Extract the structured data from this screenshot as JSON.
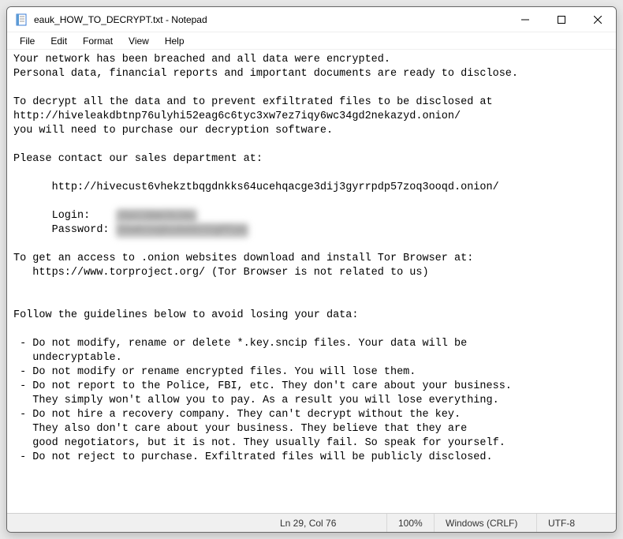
{
  "titlebar": {
    "title": "eauk_HOW_TO_DECRYPT.txt - Notepad"
  },
  "menu": {
    "file": "File",
    "edit": "Edit",
    "format": "Format",
    "view": "View",
    "help": "Help"
  },
  "body": {
    "l1": "Your network has been breached and all data were encrypted.",
    "l2": "Personal data, financial reports and important documents are ready to disclose.",
    "l3": "",
    "l4": "To decrypt all the data and to prevent exfiltrated files to be disclosed at",
    "l5": "http://hiveleakdbtnp76ulyhi52eag6c6tyc3xw7ez7iqy6wc34gd2nekazyd.onion/",
    "l6": "you will need to purchase our decryption software.",
    "l7": "",
    "l8": "Please contact our sales department at:",
    "l9": "",
    "l10": "      http://hivecust6vhekztbqgdnkks64ucehqacge3dij3gyrrpdp57zoq3ooqd.onion/",
    "l11": "",
    "l12a": "      Login:    ",
    "l12b": "YbX73bm7kl5c",
    "l13a": "      Password: ",
    "l13b": "R5wKtkQ8i8U8SlCgPFyw",
    "l14": "",
    "l15": "To get an access to .onion websites download and install Tor Browser at:",
    "l16": "   https://www.torproject.org/ (Tor Browser is not related to us)",
    "l17": "",
    "l18": "",
    "l19": "Follow the guidelines below to avoid losing your data:",
    "l20": "",
    "l21": " - Do not modify, rename or delete *.key.sncip files. Your data will be",
    "l22": "   undecryptable.",
    "l23": " - Do not modify or rename encrypted files. You will lose them.",
    "l24": " - Do not report to the Police, FBI, etc. They don't care about your business.",
    "l25": "   They simply won't allow you to pay. As a result you will lose everything.",
    "l26": " - Do not hire a recovery company. They can't decrypt without the key.",
    "l27": "   They also don't care about your business. They believe that they are",
    "l28": "   good negotiators, but it is not. They usually fail. So speak for yourself.",
    "l29": " - Do not reject to purchase. Exfiltrated files will be publicly disclosed."
  },
  "status": {
    "position": "Ln 29, Col 76",
    "zoom": "100%",
    "eol": "Windows (CRLF)",
    "encoding": "UTF-8"
  }
}
